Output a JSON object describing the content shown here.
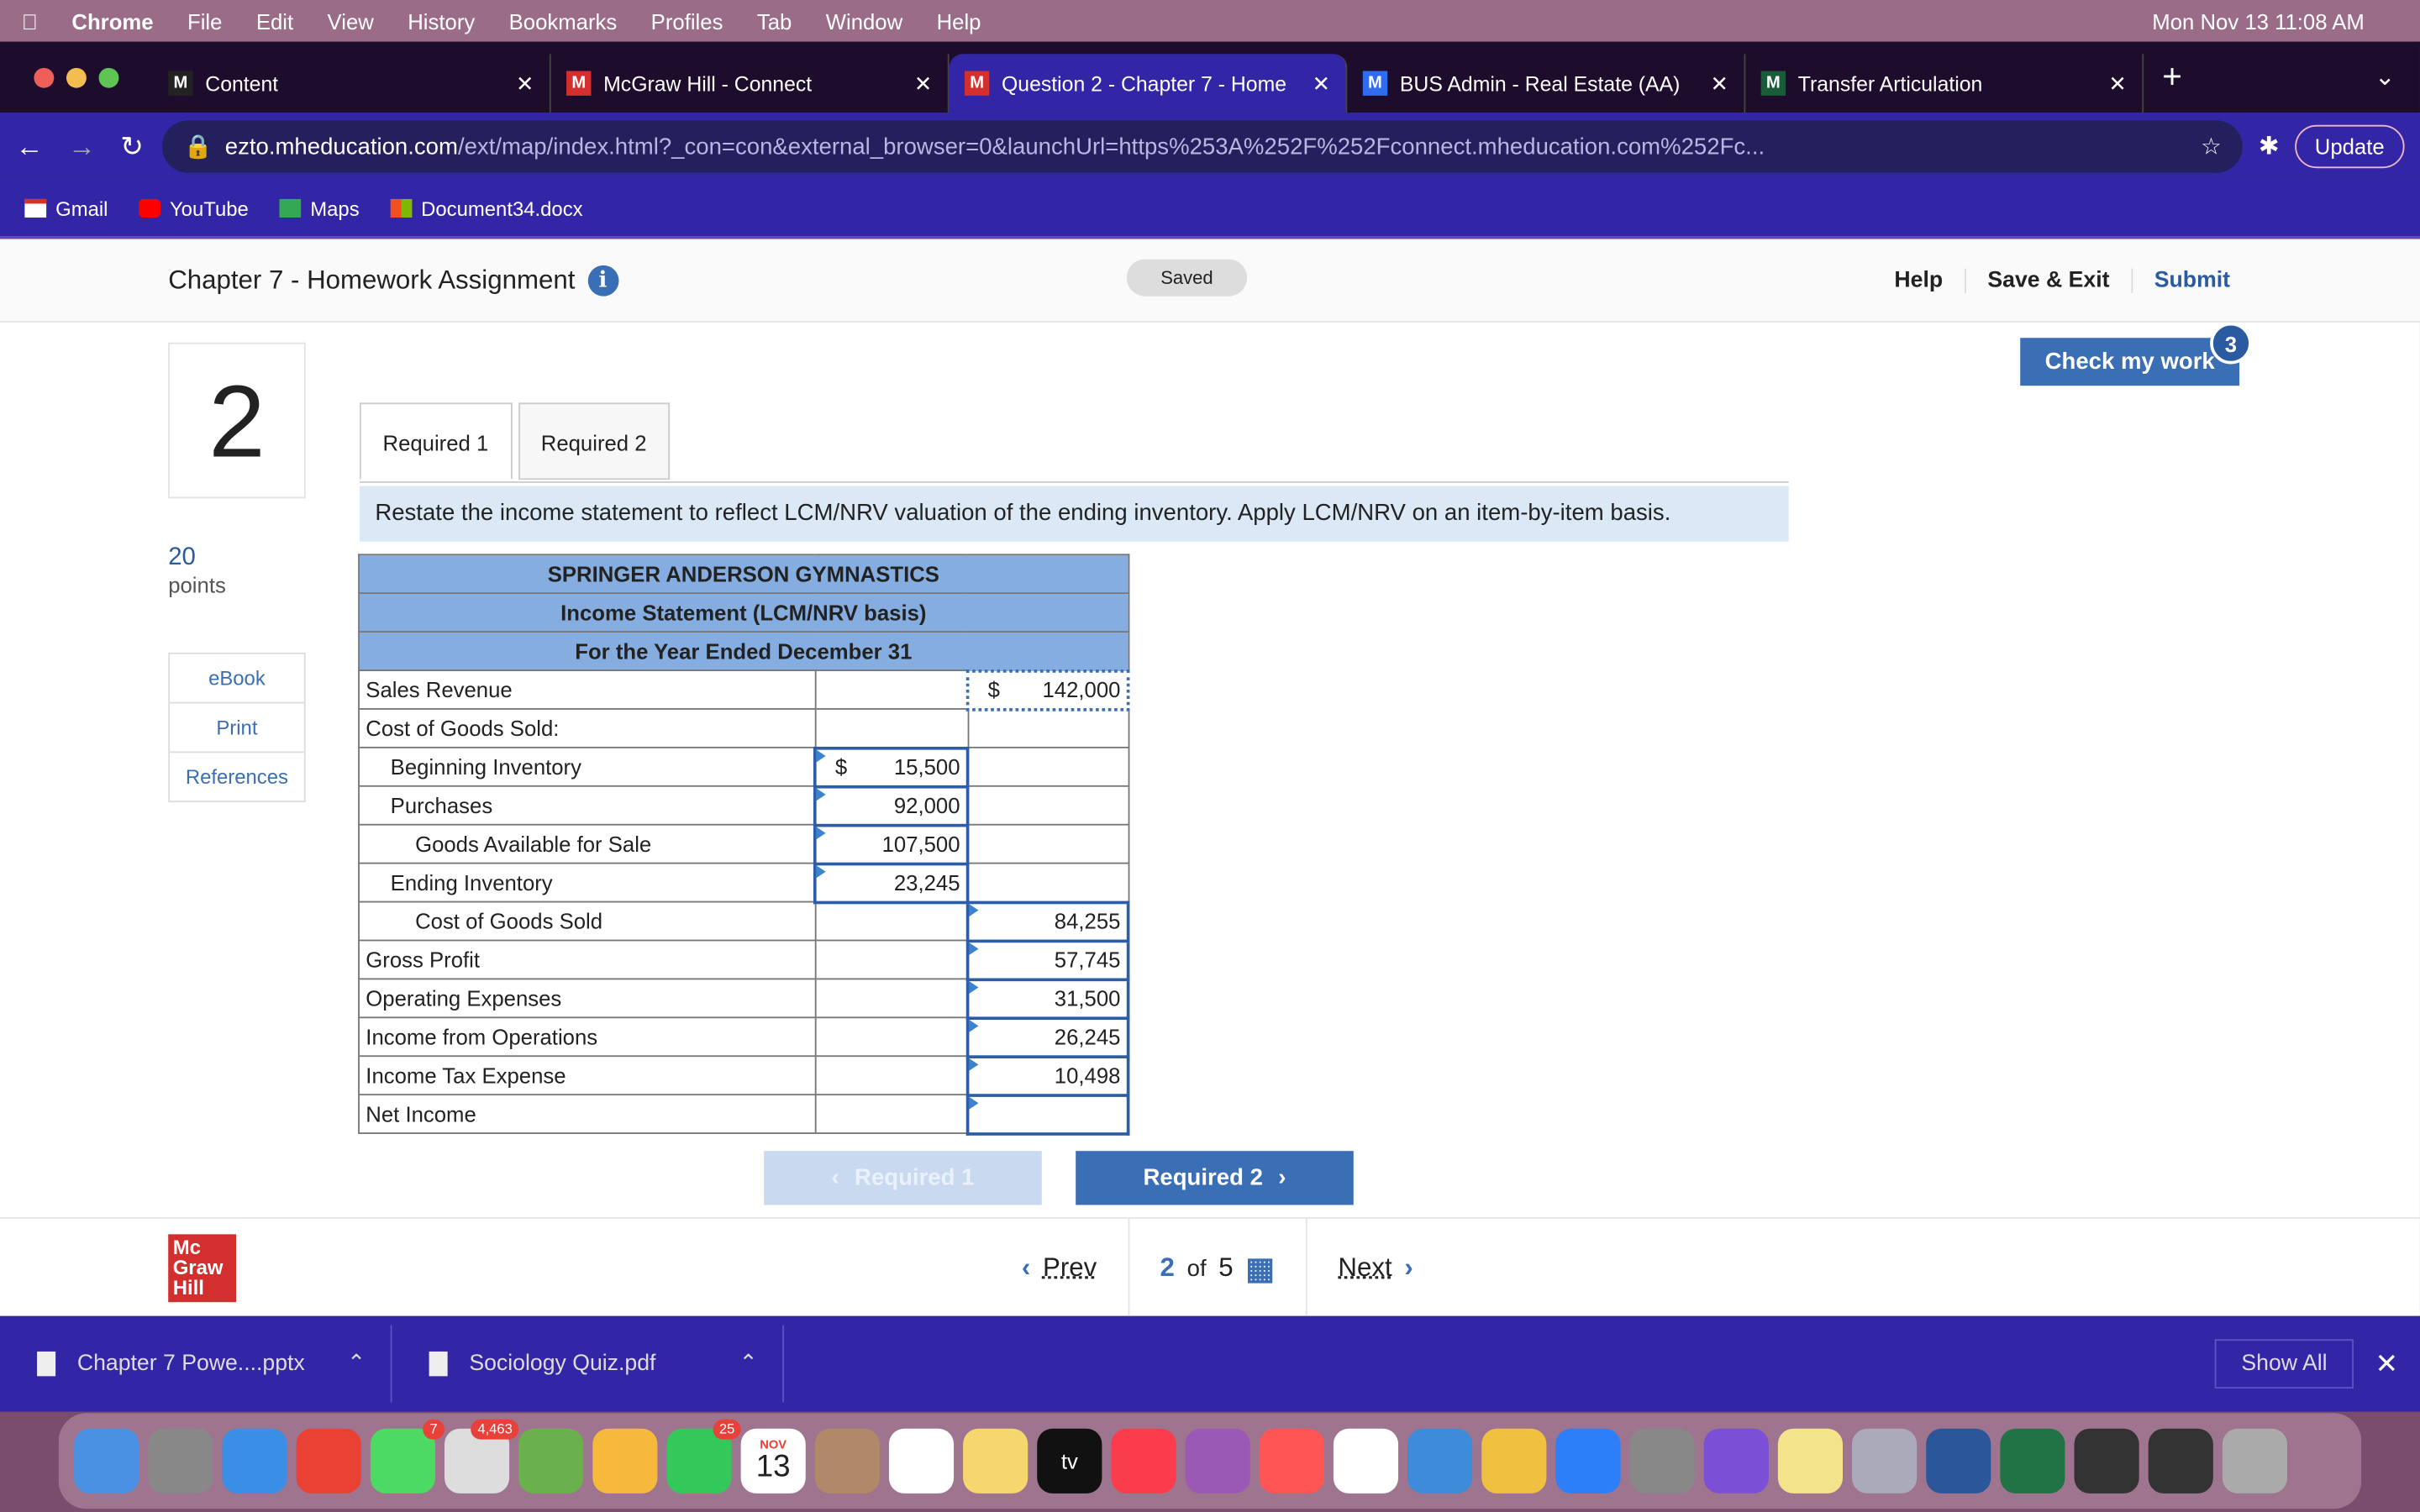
{
  "menubar": {
    "app": "Chrome",
    "items": [
      "File",
      "Edit",
      "View",
      "History",
      "Bookmarks",
      "Profiles",
      "Tab",
      "Window",
      "Help"
    ],
    "clock": "Mon Nov 13  11:08 AM"
  },
  "tabs": [
    {
      "label": "Content",
      "color": "#222"
    },
    {
      "label": "McGraw Hill - Connect",
      "color": "#d32f2f"
    },
    {
      "label": "Question 2 - Chapter 7 - Home",
      "color": "#d32f2f",
      "active": true
    },
    {
      "label": "BUS Admin - Real Estate (AA)",
      "color": "#2f6cf0"
    },
    {
      "label": "Transfer Articulation",
      "color": "#1a5b3a"
    }
  ],
  "address": {
    "host": "ezto.mheducation.com",
    "path": "/ext/map/index.html?_con=con&external_browser=0&launchUrl=https%253A%252F%252Fconnect.mheducation.com%252Fc...",
    "update": "Update"
  },
  "bookmarks": [
    "Gmail",
    "YouTube",
    "Maps",
    "Document34.docx"
  ],
  "header": {
    "title": "Chapter 7 - Homework Assignment",
    "saved": "Saved",
    "help": "Help",
    "save_exit": "Save & Exit",
    "submit": "Submit"
  },
  "question": {
    "number": "2",
    "points": "20",
    "points_label": "points",
    "side": [
      "eBook",
      "Print",
      "References"
    ],
    "check": "Check my work",
    "check_badge": "3"
  },
  "req_tabs": [
    "Required 1",
    "Required 2"
  ],
  "instruction": "Restate the income statement to reflect LCM/NRV valuation of the ending inventory. Apply LCM/NRV on an item-by-item basis.",
  "statement": {
    "company": "SPRINGER ANDERSON GYMNASTICS",
    "title": "Income Statement (LCM/NRV basis)",
    "period": "For the Year Ended December 31",
    "rows": [
      {
        "label": "Sales Revenue",
        "c1": "",
        "c2": "142,000",
        "dollar2": "$",
        "indent": 0
      },
      {
        "label": "Cost of Goods Sold:",
        "c1": "",
        "c2": "",
        "indent": 0
      },
      {
        "label": "Beginning Inventory",
        "c1": "15,500",
        "dollar1": "$",
        "c2": "",
        "indent": 1,
        "in1": true
      },
      {
        "label": "Purchases",
        "c1": "92,000",
        "c2": "",
        "indent": 1,
        "in1": true
      },
      {
        "label": "Goods Available for Sale",
        "c1": "107,500",
        "c2": "",
        "indent": 2,
        "in1": true
      },
      {
        "label": "Ending Inventory",
        "c1": "23,245",
        "c2": "",
        "indent": 1,
        "in1": true
      },
      {
        "label": "Cost of Goods Sold",
        "c1": "",
        "c2": "84,255",
        "indent": 2,
        "in2": true
      },
      {
        "label": "Gross Profit",
        "c1": "",
        "c2": "57,745",
        "indent": 0,
        "in2": true
      },
      {
        "label": "Operating Expenses",
        "c1": "",
        "c2": "31,500",
        "indent": 0,
        "in2": true
      },
      {
        "label": "Income from Operations",
        "c1": "",
        "c2": "26,245",
        "indent": 0,
        "in2": true
      },
      {
        "label": "Income Tax Expense",
        "c1": "",
        "c2": "10,498",
        "indent": 0,
        "in2": true
      },
      {
        "label": "Net Income",
        "c1": "",
        "c2": "",
        "indent": 0,
        "in2": true
      }
    ]
  },
  "nav": {
    "prev_req": "Required 1",
    "next_req": "Required 2"
  },
  "pager": {
    "prev": "Prev",
    "current": "2",
    "of": "of",
    "total": "5",
    "next": "Next"
  },
  "logo": "Mc Graw Hill",
  "downloads": [
    "Chapter 7 Powe....pptx",
    "Sociology Quiz.pdf"
  ],
  "show_all": "Show All",
  "dock_badges": {
    "messages": "7",
    "mail": "4,463",
    "facetime": "25",
    "calendar_month": "NOV",
    "calendar_day": "13",
    "tv": "tv"
  }
}
